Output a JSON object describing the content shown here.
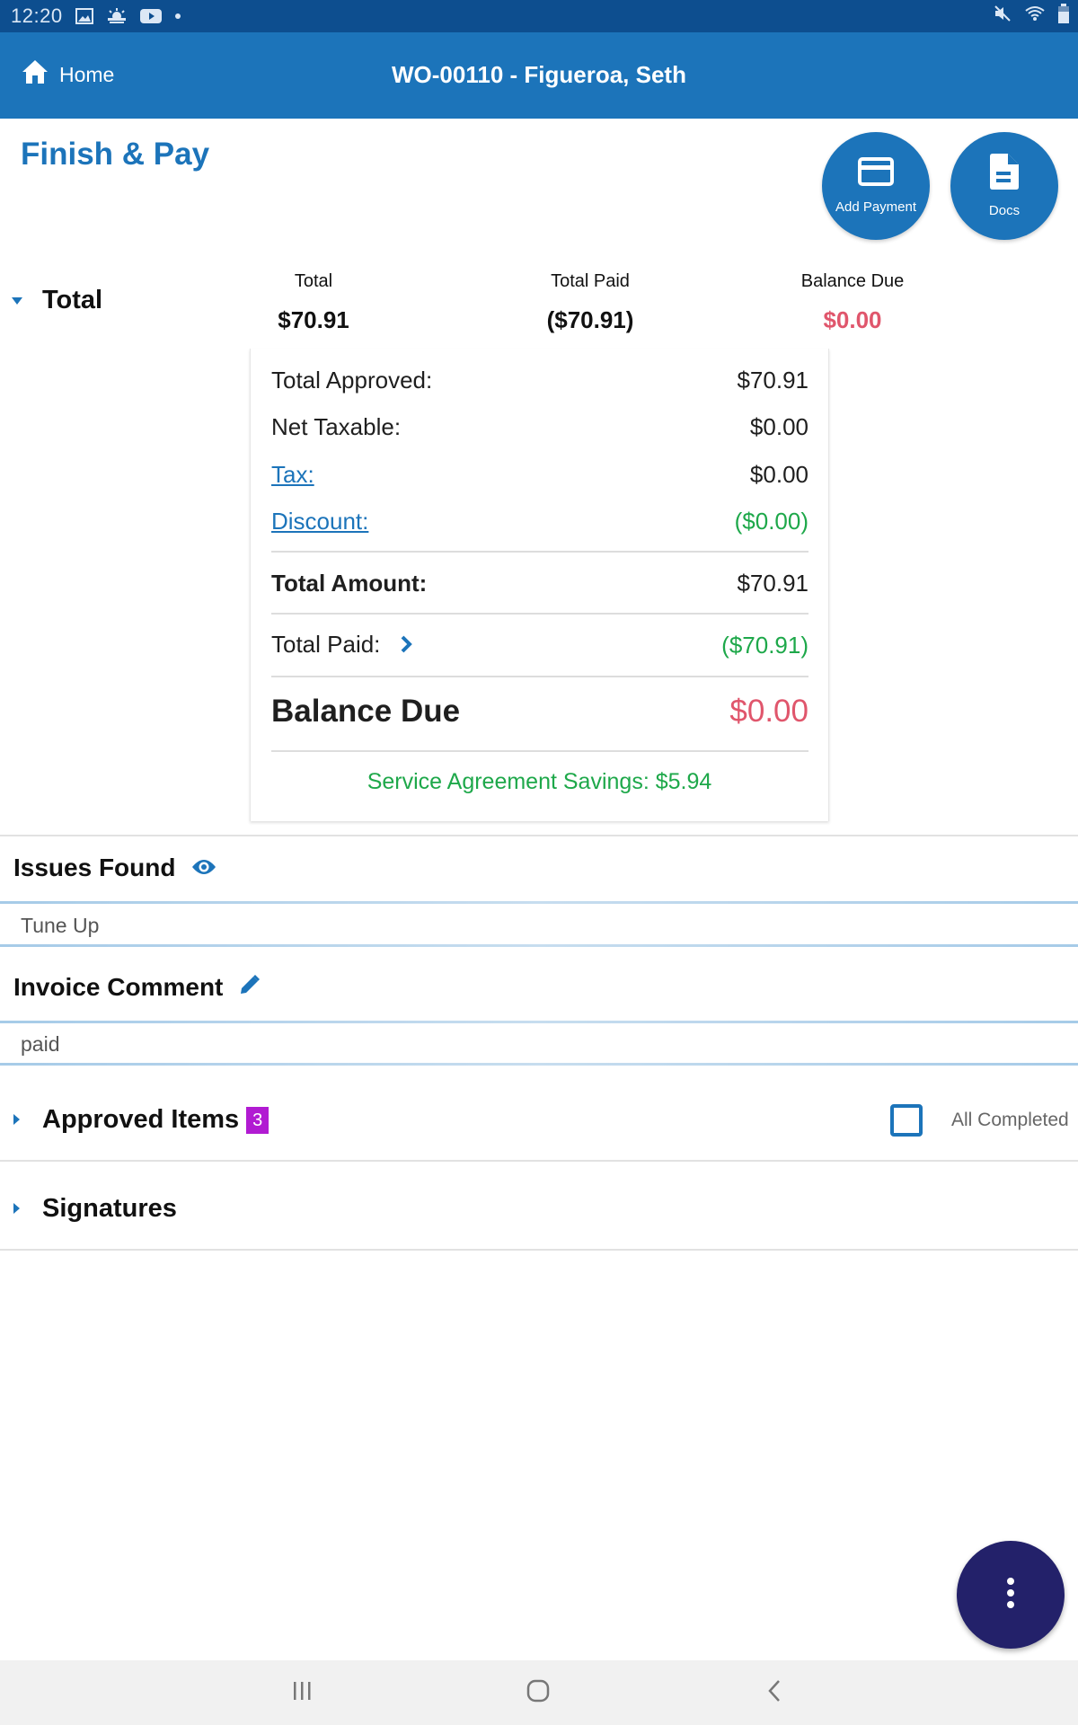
{
  "status_bar": {
    "time": "12:20",
    "left_icons": [
      "gallery-icon",
      "weather-icon",
      "youtube-icon",
      "notification-dot-icon"
    ],
    "right_icons": [
      "mute-icon",
      "wifi-icon",
      "battery-icon"
    ]
  },
  "app_bar": {
    "home_label": "Home",
    "title": "WO-00110 - Figueroa, Seth"
  },
  "page": {
    "title": "Finish & Pay",
    "actions": [
      {
        "label": "Add Payment",
        "icon": "credit-card-icon"
      },
      {
        "label": "Docs",
        "icon": "document-icon"
      }
    ]
  },
  "colors": {
    "brand": "#1c74ba",
    "status_bar": "#0d4e8f",
    "positive": "#1ea84a",
    "negative": "#e0566c",
    "badge": "#b11bd2",
    "fab": "#23216a"
  },
  "totals": {
    "heading": "Total",
    "summary": [
      {
        "label": "Total",
        "value": "$70.91"
      },
      {
        "label": "Total Paid",
        "value": "($70.91)"
      },
      {
        "label": "Balance Due",
        "value": "$0.00"
      }
    ],
    "detail": {
      "total_approved": {
        "label": "Total Approved:",
        "value": "$70.91"
      },
      "net_taxable": {
        "label": "Net Taxable:",
        "value": "$0.00"
      },
      "tax": {
        "label": "Tax:",
        "value": "$0.00"
      },
      "discount": {
        "label": "Discount:",
        "value": "($0.00)"
      },
      "total_amount": {
        "label": "Total Amount:",
        "value": "$70.91"
      },
      "total_paid": {
        "label": "Total Paid:",
        "value": "($70.91)"
      },
      "balance_due": {
        "label": "Balance Due",
        "value": "$0.00"
      },
      "savings": "Service Agreement Savings: $5.94"
    }
  },
  "issues_found": {
    "title": "Issues Found",
    "text": "Tune Up"
  },
  "invoice_comment": {
    "title": "Invoice Comment",
    "text": "paid"
  },
  "approved_items": {
    "title": "Approved Items",
    "count": "3",
    "all_completed_label": "All Completed",
    "all_completed_checked": false
  },
  "signatures": {
    "title": "Signatures"
  }
}
